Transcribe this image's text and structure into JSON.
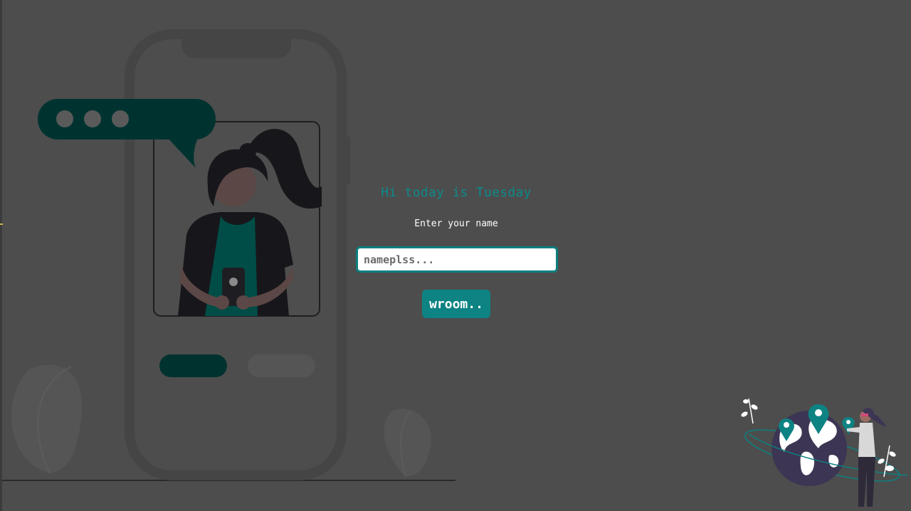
{
  "greeting": "Hi today is Tuesday",
  "form": {
    "prompt_label": "Enter your name",
    "name_placeholder": "nameplss...",
    "name_value": "",
    "submit_label": "wroom.."
  },
  "colors": {
    "background": "#4d4d4d",
    "accent_teal": "#0d8a8a",
    "dark_teal": "#003330",
    "phone_frame": "#454545"
  },
  "icons": {
    "phone_illustration": "phone-chat-illustration",
    "globe_illustration": "world-map-travel-illustration"
  }
}
